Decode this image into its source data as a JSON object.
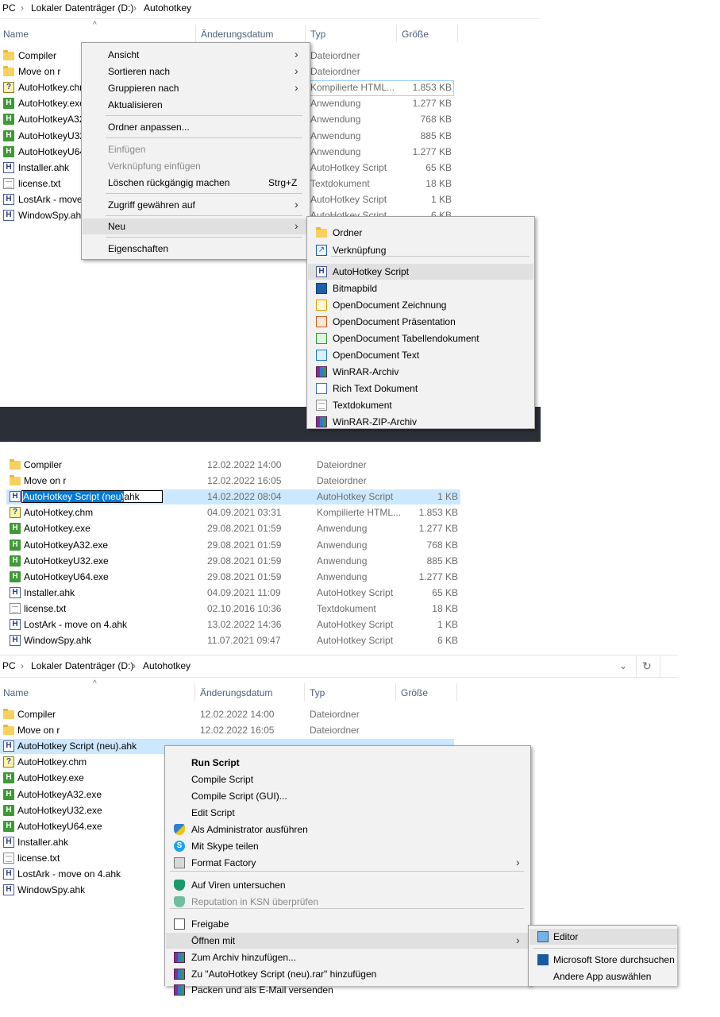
{
  "panel1": {
    "breadcrumb": [
      "PC",
      "Lokaler Datenträger (D:)",
      "Autohotkey"
    ],
    "columns": [
      "Name",
      "Änderungsdatum",
      "Typ",
      "Größe"
    ],
    "files": [
      {
        "name": "Compiler",
        "type": "Dateiordner",
        "size": "",
        "icon": "folder"
      },
      {
        "name": "Move on r",
        "type": "Dateiordner",
        "size": "",
        "icon": "folder"
      },
      {
        "name": "AutoHotkey.chm",
        "type": "Kompilierte HTML...",
        "size": "1.853 KB",
        "icon": "chm"
      },
      {
        "name": "AutoHotkey.exe",
        "type": "Anwendung",
        "size": "1.277 KB",
        "icon": "exe"
      },
      {
        "name": "AutoHotkeyA32",
        "type": "Anwendung",
        "size": "768 KB",
        "icon": "exe"
      },
      {
        "name": "AutoHotkeyU32",
        "type": "Anwendung",
        "size": "885 KB",
        "icon": "exe"
      },
      {
        "name": "AutoHotkeyU64",
        "type": "Anwendung",
        "size": "1.277 KB",
        "icon": "exe"
      },
      {
        "name": "Installer.ahk",
        "type": "AutoHotkey Script",
        "size": "65 KB",
        "icon": "ahk"
      },
      {
        "name": "license.txt",
        "type": "Textdokument",
        "size": "18 KB",
        "icon": "txt"
      },
      {
        "name": "LostArk - move",
        "type": "AutoHotkey Script",
        "size": "1 KB",
        "icon": "ahk"
      },
      {
        "name": "WindowSpy.ahk",
        "type": "AutoHotkey Script",
        "size": "6 KB",
        "icon": "ahk"
      }
    ],
    "context_menu": {
      "view": "Ansicht",
      "sort": "Sortieren nach",
      "group": "Gruppieren nach",
      "refresh": "Aktualisieren",
      "customize": "Ordner anpassen...",
      "paste": "Einfügen",
      "paste_shortcut": "Verknüpfung einfügen",
      "undo": "Löschen rückgängig machen",
      "undo_shortcut": "Strg+Z",
      "access": "Zugriff gewähren auf",
      "new": "Neu",
      "properties": "Eigenschaften"
    },
    "new_submenu": [
      {
        "label": "Ordner",
        "icon": "folder"
      },
      {
        "label": "Verknüpfung",
        "icon": "shortcut"
      },
      {
        "label": "AutoHotkey Script",
        "icon": "ahk"
      },
      {
        "label": "Bitmapbild",
        "icon": "bitmap"
      },
      {
        "label": "OpenDocument Zeichnung",
        "icon": "odg"
      },
      {
        "label": "OpenDocument Präsentation",
        "icon": "odp"
      },
      {
        "label": "OpenDocument Tabellendokument",
        "icon": "ods"
      },
      {
        "label": "OpenDocument Text",
        "icon": "odt"
      },
      {
        "label": "WinRAR-Archiv",
        "icon": "rar"
      },
      {
        "label": "Rich Text Dokument",
        "icon": "rtf"
      },
      {
        "label": "Textdokument",
        "icon": "txt"
      },
      {
        "label": "WinRAR-ZIP-Archiv",
        "icon": "rar"
      }
    ]
  },
  "panel2": {
    "rename_value": "AutoHotkey Script (neu)",
    "rename_ext": ".ahk",
    "files": [
      {
        "name": "Compiler",
        "date": "12.02.2022 14:00",
        "type": "Dateiordner",
        "size": "",
        "icon": "folder"
      },
      {
        "name": "Move on r",
        "date": "12.02.2022 16:05",
        "type": "Dateiordner",
        "size": "",
        "icon": "folder"
      },
      {
        "name": "",
        "date": "14.02.2022 08:04",
        "type": "AutoHotkey Script",
        "size": "1 KB",
        "icon": "ahk"
      },
      {
        "name": "AutoHotkey.chm",
        "date": "04.09.2021 03:31",
        "type": "Kompilierte HTML...",
        "size": "1.853 KB",
        "icon": "chm"
      },
      {
        "name": "AutoHotkey.exe",
        "date": "29.08.2021 01:59",
        "type": "Anwendung",
        "size": "1.277 KB",
        "icon": "exe"
      },
      {
        "name": "AutoHotkeyA32.exe",
        "date": "29.08.2021 01:59",
        "type": "Anwendung",
        "size": "768 KB",
        "icon": "exe"
      },
      {
        "name": "AutoHotkeyU32.exe",
        "date": "29.08.2021 01:59",
        "type": "Anwendung",
        "size": "885 KB",
        "icon": "exe"
      },
      {
        "name": "AutoHotkeyU64.exe",
        "date": "29.08.2021 01:59",
        "type": "Anwendung",
        "size": "1.277 KB",
        "icon": "exe"
      },
      {
        "name": "Installer.ahk",
        "date": "04.09.2021 11:09",
        "type": "AutoHotkey Script",
        "size": "65 KB",
        "icon": "ahk"
      },
      {
        "name": "license.txt",
        "date": "02.10.2016 10:36",
        "type": "Textdokument",
        "size": "18 KB",
        "icon": "txt"
      },
      {
        "name": "LostArk - move on 4.ahk",
        "date": "13.02.2022 14:36",
        "type": "AutoHotkey Script",
        "size": "1 KB",
        "icon": "ahk"
      },
      {
        "name": "WindowSpy.ahk",
        "date": "11.07.2021 09:47",
        "type": "AutoHotkey Script",
        "size": "6 KB",
        "icon": "ahk"
      }
    ]
  },
  "panel3": {
    "breadcrumb": [
      "PC",
      "Lokaler Datenträger (D:)",
      "Autohotkey"
    ],
    "columns": [
      "Name",
      "Änderungsdatum",
      "Typ",
      "Größe"
    ],
    "files": [
      {
        "name": "Compiler",
        "date": "12.02.2022 14:00",
        "type": "Dateiordner",
        "icon": "folder"
      },
      {
        "name": "Move on r",
        "date": "12.02.2022 16:05",
        "type": "Dateiordner",
        "icon": "folder"
      },
      {
        "name": "AutoHotkey Script (neu).ahk",
        "date": "",
        "type": "",
        "icon": "ahk"
      },
      {
        "name": "AutoHotkey.chm",
        "icon": "chm"
      },
      {
        "name": "AutoHotkey.exe",
        "icon": "exe"
      },
      {
        "name": "AutoHotkeyA32.exe",
        "icon": "exe"
      },
      {
        "name": "AutoHotkeyU32.exe",
        "icon": "exe"
      },
      {
        "name": "AutoHotkeyU64.exe",
        "icon": "exe"
      },
      {
        "name": "Installer.ahk",
        "icon": "ahk"
      },
      {
        "name": "license.txt",
        "icon": "txt"
      },
      {
        "name": "LostArk - move on 4.ahk",
        "icon": "ahk"
      },
      {
        "name": "WindowSpy.ahk",
        "icon": "ahk"
      }
    ],
    "context_menu": {
      "run": "Run Script",
      "compile": "Compile Script",
      "compile_gui": "Compile Script (GUI)...",
      "edit": "Edit Script",
      "admin": "Als Administrator ausführen",
      "skype": "Mit Skype teilen",
      "format_factory": "Format Factory",
      "scan": "Auf Viren untersuchen",
      "ksn": "Reputation in KSN überprüfen",
      "share": "Freigabe",
      "open_with": "Öffnen mit",
      "archive": "Zum Archiv hinzufügen...",
      "archive_rar": "Zu \"AutoHotkey Script (neu).rar\" hinzufügen",
      "pack_email": "Packen und als E-Mail versenden"
    },
    "open_with_submenu": {
      "editor": "Editor",
      "store": "Microsoft Store durchsuchen",
      "other": "Andere App auswählen"
    }
  }
}
